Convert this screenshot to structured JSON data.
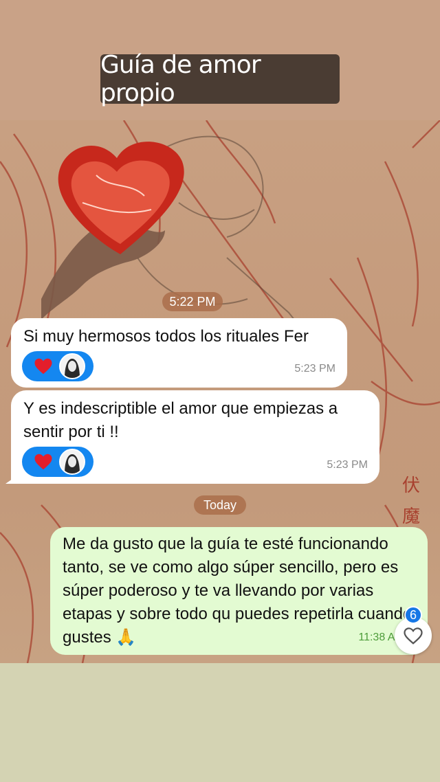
{
  "story": {
    "title": "Guía de amor propio"
  },
  "chat": {
    "date_chip_1": "5:22 PM",
    "messages": [
      {
        "text": "Si muy hermosos todos los rituales Fer",
        "time": "5:23 PM"
      },
      {
        "text": "Y es indescriptible el amor que empiezas a sentir por ti !!",
        "time": "5:23 PM"
      },
      {
        "text": "Me da gusto que la guía te esté funcionando tanto, se ve como algo súper sencillo, pero es súper poderoso y te va llevando por varias etapas y sobre todo qu puedes repetirla cuando gustes 🙏",
        "time": "11:38 Al"
      }
    ],
    "date_chip_2": "Today"
  },
  "reactions": {
    "heart_icon": "red-heart-icon",
    "avatar_icon": "woman-avatar-icon"
  },
  "like": {
    "count": "6",
    "icon": "heart-outline-icon"
  },
  "artwork": {
    "kanji_1": "伏",
    "kanji_2": "魔"
  },
  "colors": {
    "incoming": "#ffffff",
    "outgoing": "#e3fbd2",
    "accent": "#1487f0",
    "title_bg": "#4a3c33"
  }
}
